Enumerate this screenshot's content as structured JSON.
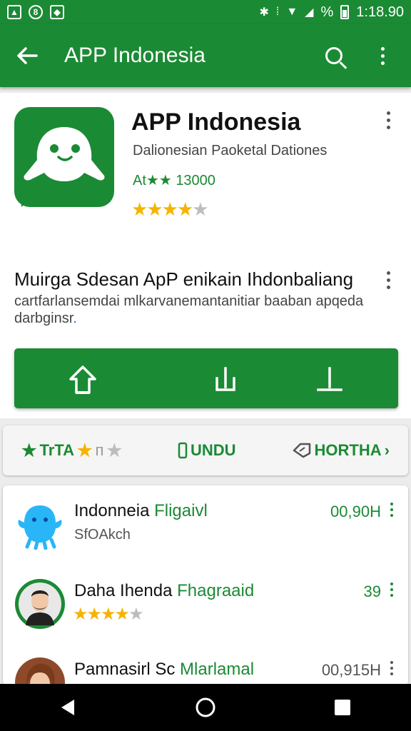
{
  "status_bar": {
    "time": "1:18.90",
    "battery_text": "%",
    "colors": {
      "background": "#1b8a34"
    }
  },
  "app_bar": {
    "title": "APP Indonesia",
    "icons": [
      "arrow-back-icon",
      "search-icon",
      "more-vert-icon"
    ]
  },
  "app": {
    "name": "APP Indonesia",
    "developer": "Dalionesian Paoketal  Dationes",
    "downloads": "At★★ 13000",
    "rating_stars": 4,
    "rating_max": 5
  },
  "description": {
    "title": "Muirga Sdesan ApP enikain Ihdonbaliang",
    "text": "cartfarlansemdai mlkarvanemantanitiar baaban apqeda darbginsr",
    "text_tail": "."
  },
  "actions": [
    {
      "icon": "home-upload-icon"
    },
    {
      "icon": "download-icon"
    },
    {
      "icon": "install-icon"
    }
  ],
  "tabs": {
    "rating": {
      "label": "TrTA",
      "suffix": "п"
    },
    "undu": {
      "label": "UNDU"
    },
    "hortha": {
      "label": "HORTHA",
      "chevron": "›"
    }
  },
  "list": [
    {
      "title": "Indonneia",
      "title_accent": "Fligaivl",
      "subtitle": "SfOAkch",
      "value": "00,90H",
      "value_color": "green",
      "icon": "blue-creature-icon"
    },
    {
      "title": "Daha Ihenda",
      "title_accent": "Fhagraaid",
      "rating_stars": 4,
      "value": "39",
      "value_color": "green",
      "icon": "man-avatar-icon"
    },
    {
      "title": "Pamnasirl Sc",
      "title_accent": "Mlarlamal",
      "value": "00,915H",
      "value_color": "gray",
      "icon": "woman-avatar-icon"
    }
  ],
  "nav_bar": {
    "buttons": [
      "back-triangle-icon",
      "home-circle-icon",
      "recents-square-icon"
    ]
  },
  "colors": {
    "brand_green": "#1b8a34",
    "star_gold": "#f4b400",
    "star_gray": "#bdbdbd"
  }
}
